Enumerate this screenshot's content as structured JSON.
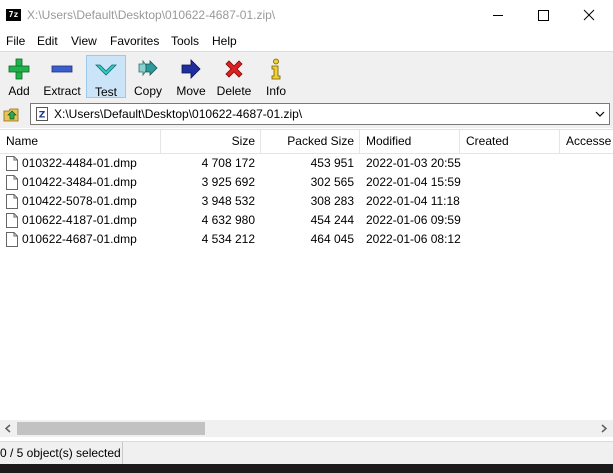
{
  "window": {
    "title": "X:\\Users\\Default\\Desktop\\010622-4687-01.zip\\",
    "app_icon_text": "7z"
  },
  "menu": [
    "File",
    "Edit",
    "View",
    "Favorites",
    "Tools",
    "Help"
  ],
  "toolbar": {
    "buttons": [
      {
        "label": "Add",
        "icon": "add-icon"
      },
      {
        "label": "Extract",
        "icon": "extract-icon"
      },
      {
        "label": "Test",
        "icon": "test-icon"
      },
      {
        "label": "Copy",
        "icon": "copy-icon"
      },
      {
        "label": "Move",
        "icon": "move-icon"
      },
      {
        "label": "Delete",
        "icon": "delete-icon"
      },
      {
        "label": "Info",
        "icon": "info-icon"
      }
    ]
  },
  "address": {
    "path": "X:\\Users\\Default\\Desktop\\010622-4687-01.zip\\"
  },
  "columns": [
    "Name",
    "Size",
    "Packed Size",
    "Modified",
    "Created",
    "Accesse"
  ],
  "files": [
    {
      "name": "010322-4484-01.dmp",
      "size": "4 708 172",
      "packed": "453 951",
      "modified": "2022-01-03 20:55"
    },
    {
      "name": "010422-3484-01.dmp",
      "size": "3 925 692",
      "packed": "302 565",
      "modified": "2022-01-04 15:59"
    },
    {
      "name": "010422-5078-01.dmp",
      "size": "3 948 532",
      "packed": "308 283",
      "modified": "2022-01-04 11:18"
    },
    {
      "name": "010622-4187-01.dmp",
      "size": "4 632 980",
      "packed": "454 244",
      "modified": "2022-01-06 09:59"
    },
    {
      "name": "010622-4687-01.dmp",
      "size": "4 534 212",
      "packed": "464 045",
      "modified": "2022-01-06 08:12"
    }
  ],
  "status": {
    "text": "0 / 5 object(s) selected"
  },
  "colors": {
    "accent": "#cce4f7",
    "accent_border": "#99c9ef",
    "taskbar": "#1b1b1b"
  }
}
